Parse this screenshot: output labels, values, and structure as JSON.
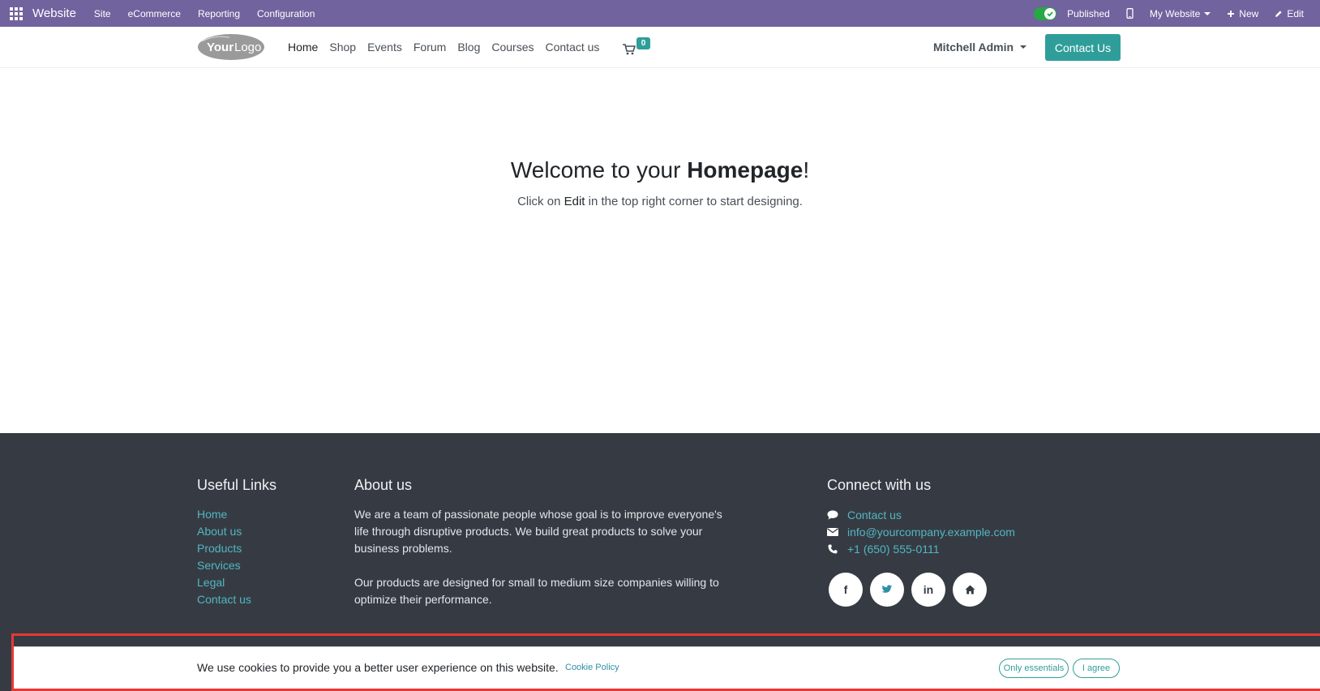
{
  "adminbar": {
    "brand": "Website",
    "menu": [
      "Site",
      "eCommerce",
      "Reporting",
      "Configuration"
    ],
    "published_label": "Published",
    "website_label": "My Website",
    "new_label": "New",
    "edit_label": "Edit"
  },
  "header": {
    "nav": [
      "Home",
      "Shop",
      "Events",
      "Forum",
      "Blog",
      "Courses",
      "Contact us"
    ],
    "cart_count": "0",
    "user_name": "Mitchell Admin",
    "cta_label": "Contact Us"
  },
  "main": {
    "welcome_prefix": "Welcome to your ",
    "welcome_bold": "Homepage",
    "welcome_suffix": "!",
    "sub_prefix": "Click on ",
    "sub_bold": "Edit",
    "sub_suffix": " in the top right corner to start designing."
  },
  "footer": {
    "useful_title": "Useful Links",
    "useful_links": [
      "Home",
      "About us",
      "Products",
      "Services",
      "Legal",
      "Contact us"
    ],
    "about_title": "About us",
    "about_p1": "We are a team of passionate people whose goal is to improve everyone's life through disruptive products. We build great products to solve your business problems.",
    "about_p2": "Our products are designed for small to medium size companies willing to optimize their performance.",
    "connect_title": "Connect with us",
    "contact_link": "Contact us",
    "email": "info@yourcompany.example.com",
    "phone": "+1 (650) 555-0111",
    "social_icons": [
      "facebook-icon",
      "twitter-icon",
      "linkedin-icon",
      "home-icon"
    ]
  },
  "cookie": {
    "message": "We use cookies to provide you a better user experience on this website.",
    "policy_label": "Cookie Policy",
    "essentials_label": "Only essentials",
    "agree_label": "I agree"
  },
  "colors": {
    "admin_bar": "#71639e",
    "primary": "#2f9e9a",
    "footer_bg": "#363b43",
    "footer_link": "#52b6c2",
    "highlight": "#e53935"
  }
}
